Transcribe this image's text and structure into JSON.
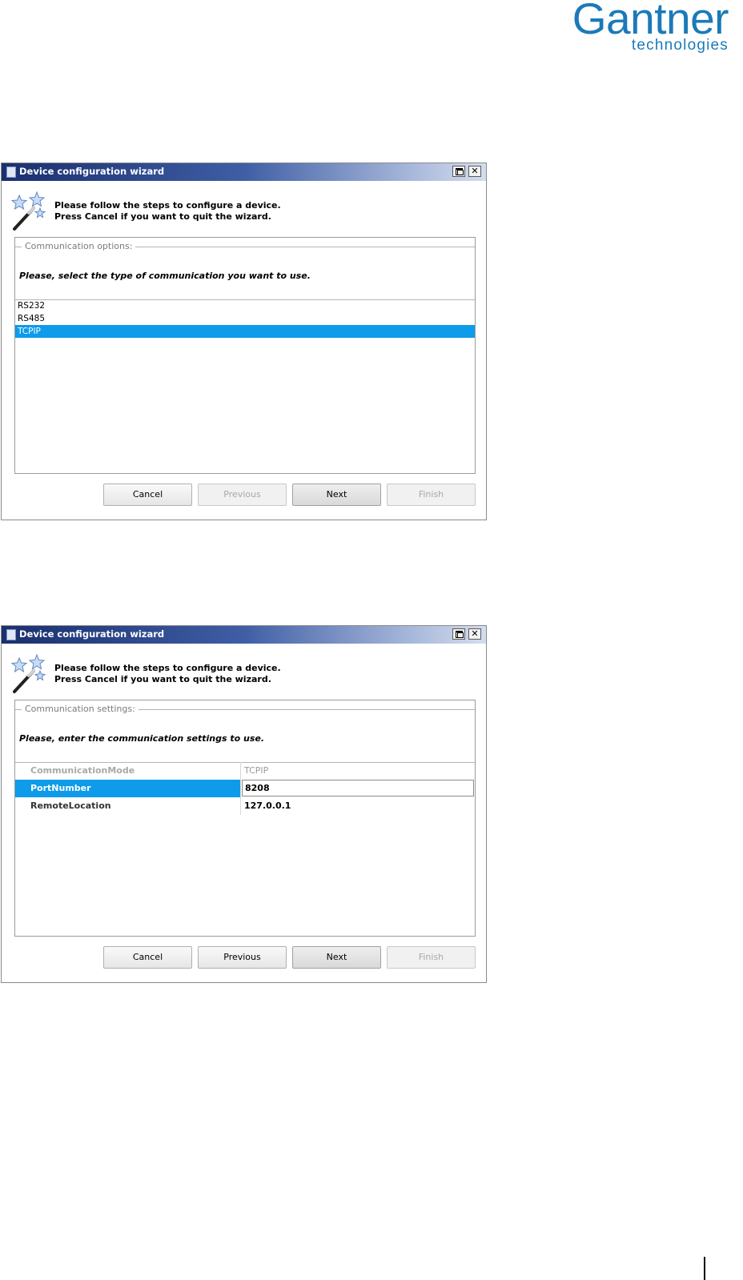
{
  "logo": {
    "name": "Gantner",
    "tagline": "technologies"
  },
  "dialog1": {
    "title": "Device configuration wizard",
    "intro_line1": "Please follow the steps to configure a device.",
    "intro_line2": "Press Cancel if you want to quit the wizard.",
    "group_title": "Communication options:",
    "instruction": "Please, select the type of communication you want to use.",
    "options": [
      "RS232",
      "RS485",
      "TCPIP"
    ],
    "selected_option": "TCPIP",
    "buttons": {
      "cancel": "Cancel",
      "previous": "Previous",
      "next": "Next",
      "finish": "Finish"
    },
    "disabled_buttons": [
      "Previous",
      "Finish"
    ]
  },
  "dialog2": {
    "title": "Device configuration wizard",
    "intro_line1": "Please follow the steps to configure a device.",
    "intro_line2": "Press Cancel if you want to quit the wizard.",
    "group_title": "Communication settings:",
    "instruction": "Please, enter the communication settings to use.",
    "settings": [
      {
        "name": "CommunicationMode",
        "value": "TCPIP",
        "state": "disabled"
      },
      {
        "name": "PortNumber",
        "value": "8208",
        "state": "selected"
      },
      {
        "name": "RemoteLocation",
        "value": "127.0.0.1",
        "state": "normal"
      }
    ],
    "buttons": {
      "cancel": "Cancel",
      "previous": "Previous",
      "next": "Next",
      "finish": "Finish"
    },
    "disabled_buttons": [
      "Finish"
    ]
  },
  "colors": {
    "brand": "#1b7ab8",
    "selection": "#0d9bea",
    "titlebar": "#1a2f6e"
  },
  "icons": [
    "window-icon",
    "restore-icon",
    "close-icon",
    "magic-wand-icon"
  ]
}
